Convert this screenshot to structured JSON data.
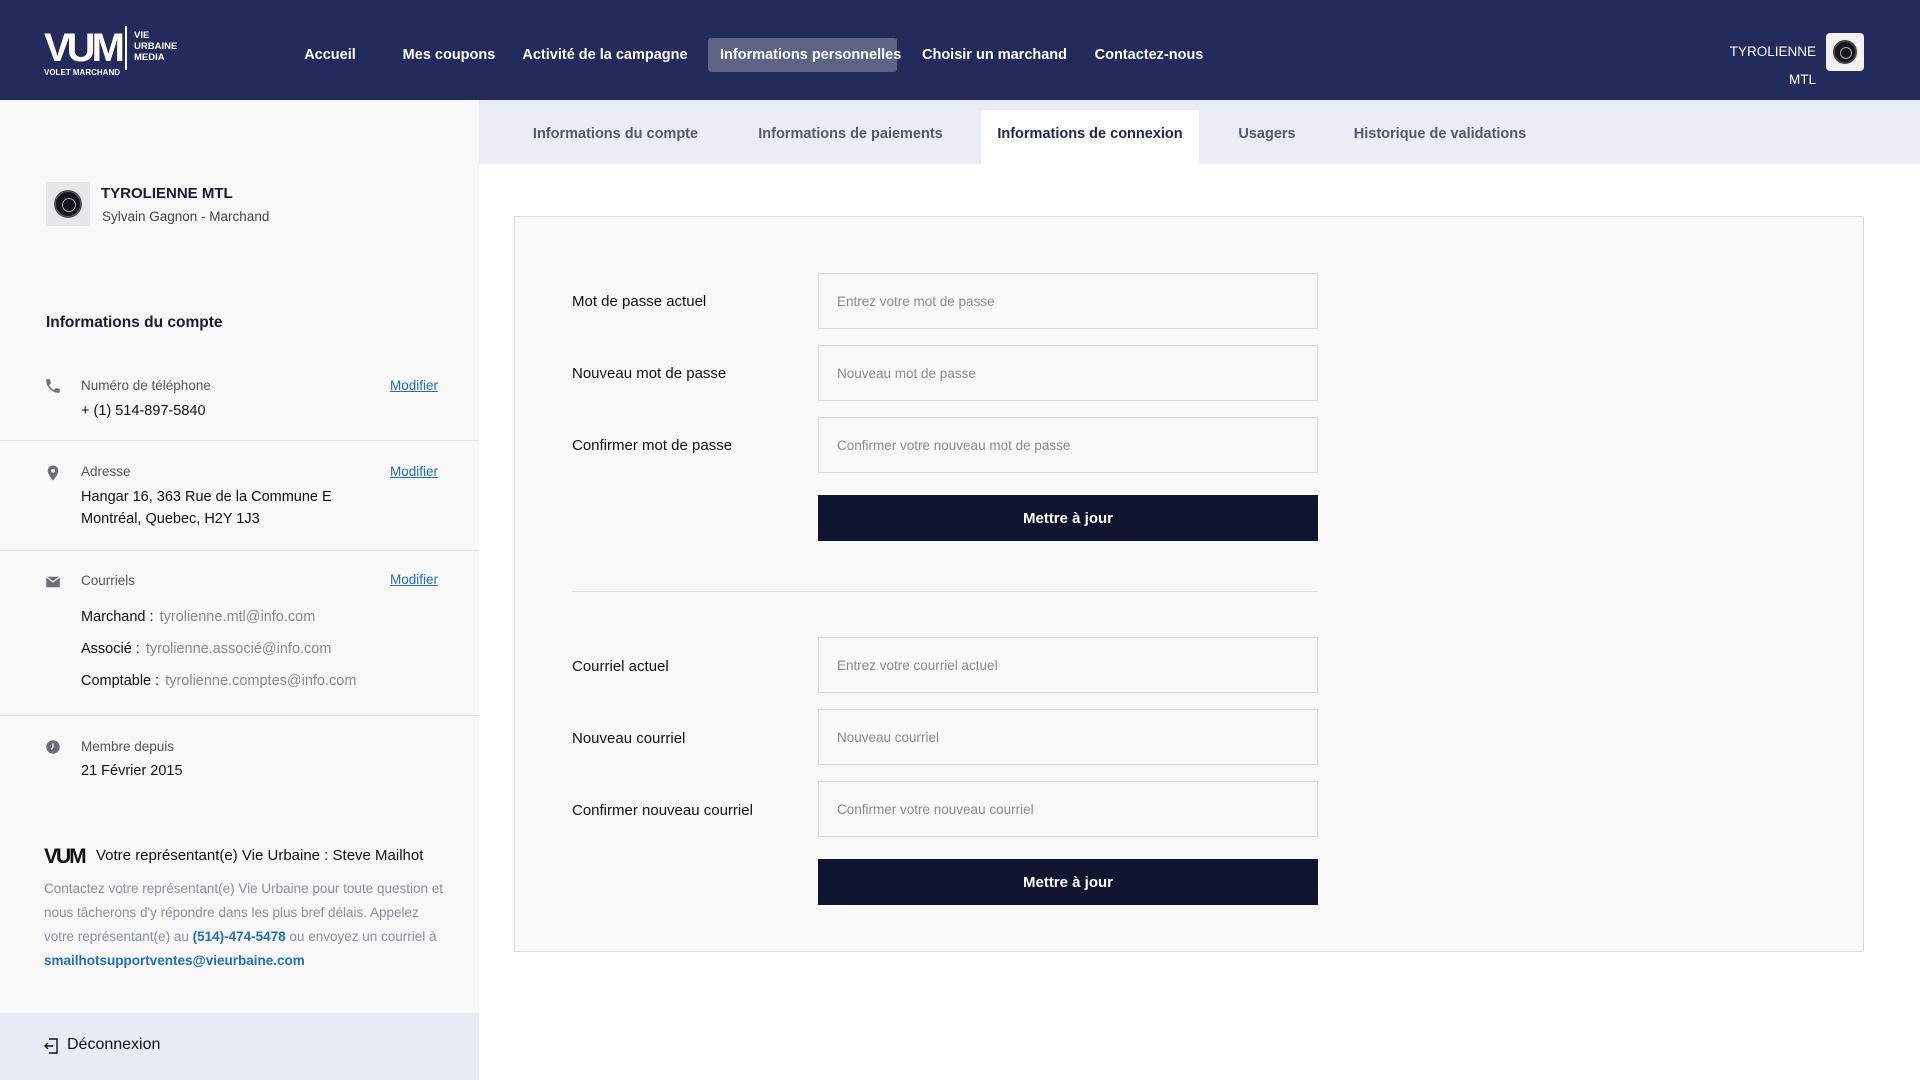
{
  "brand": {
    "logo_mark": "VUM",
    "logo_words": [
      "VIE",
      "URBAINE",
      "MEDIA"
    ],
    "logo_sub": "VOLET MARCHAND"
  },
  "nav": {
    "items": [
      {
        "label": "Accueil"
      },
      {
        "label": "Mes coupons"
      },
      {
        "label": "Activité de la campagne"
      },
      {
        "label": "Informations personnelles",
        "active": true
      },
      {
        "label": "Choisir un marchand"
      },
      {
        "label": "Contactez-nous"
      }
    ],
    "user_name": "TYROLIENNE MTL"
  },
  "sidebar": {
    "merchant_name": "TYROLIENNE MTL",
    "merchant_sub": "Sylvain Gagnon - Marchand",
    "section_title": "Informations du compte",
    "phone": {
      "label": "Numéro de téléphone",
      "value": "+ (1) 514-897-5840",
      "icon": "phone-icon"
    },
    "address": {
      "label": "Adresse",
      "line1": "Hangar 16, 363 Rue de la Commune E",
      "line2": "Montréal, Quebec, H2Y 1J3",
      "icon": "location-pin-icon"
    },
    "emails": {
      "label": "Courriels",
      "icon": "envelope-icon",
      "rows": [
        {
          "role": "Marchand :",
          "value": "tyrolienne.mtl@info.com"
        },
        {
          "role": "Associé :",
          "value": "tyrolienne.associé@info.com"
        },
        {
          "role": "Comptable :",
          "value": "tyrolienne.comptes@info.com"
        }
      ]
    },
    "member_since": {
      "label": "Membre depuis",
      "value": "21 Février 2015",
      "icon": "clock-icon"
    },
    "modify_label": "Modifier",
    "rep": {
      "logo": "VUM",
      "title": "Votre représentant(e) Vie Urbaine : Steve Mailhot",
      "text_1": "Contactez votre représentant(e) Vie Urbaine pour toute question et nous tâcherons d'y répondre dans les plus bref délais. Appelez votre représentant(e) au ",
      "phone": "(514)-474-5478",
      "text_2": " ou envoyez un courriel à ",
      "email": "smailhotsupportventes@vieurbaine.com"
    },
    "logout_label": "Déconnexion"
  },
  "tabs": [
    {
      "label": "Informations du compte"
    },
    {
      "label": "Informations de paiements"
    },
    {
      "label": "Informations de connexion",
      "active": true
    },
    {
      "label": "Usagers"
    },
    {
      "label": "Historique de validations"
    }
  ],
  "form": {
    "password": {
      "current_label": "Mot de passe actuel",
      "current_placeholder": "Entrez votre mot de passe",
      "new_label": "Nouveau mot de passe",
      "new_placeholder": "Nouveau mot de passe",
      "confirm_label": "Confirmer mot de passe",
      "confirm_placeholder": "Confirmer votre nouveau mot de passe",
      "button": "Mettre à jour"
    },
    "email": {
      "current_label": "Courriel actuel",
      "current_placeholder": "Entrez votre courriel actuel",
      "new_label": "Nouveau courriel",
      "new_placeholder": "Nouveau courriel",
      "confirm_label": "Confirmer nouveau courriel",
      "confirm_placeholder": "Confirmer votre nouveau courriel",
      "button": "Mettre à jour"
    }
  },
  "colors": {
    "topbar": "#232a5c",
    "nav_active": "#5c6486",
    "button": "#11142e",
    "link": "#1f6fbf"
  }
}
